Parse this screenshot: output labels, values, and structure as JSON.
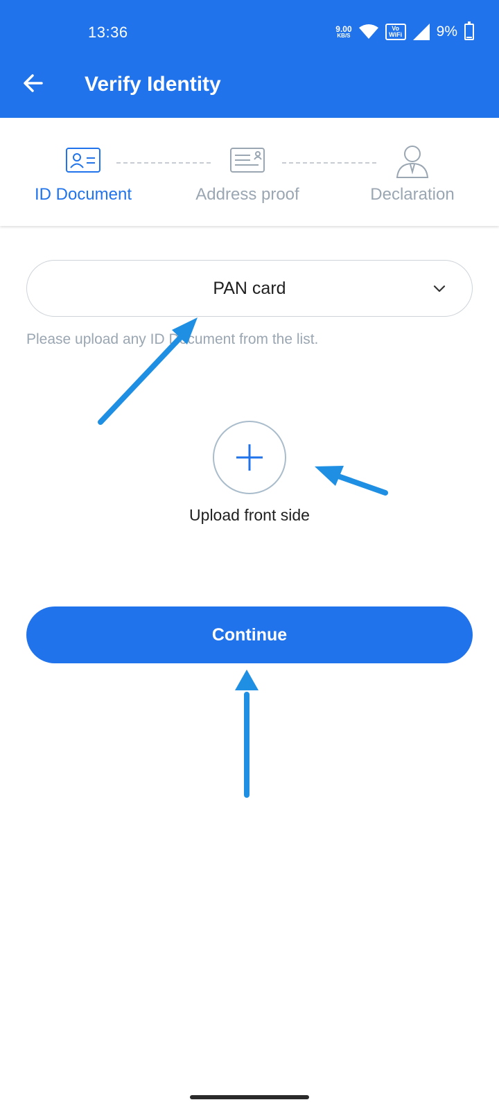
{
  "status_bar": {
    "time": "13:36",
    "net_speed_value": "9.00",
    "net_speed_unit": "KB/S",
    "vowifi_top": "Vo",
    "vowifi_bottom": "WiFi",
    "battery": "9%"
  },
  "header": {
    "title": "Verify Identity",
    "back_icon": "arrow-left-icon"
  },
  "stepper": {
    "steps": [
      {
        "label": "ID Document",
        "icon": "id-card-icon",
        "active": true
      },
      {
        "label": "Address proof",
        "icon": "address-card-icon",
        "active": false
      },
      {
        "label": "Declaration",
        "icon": "person-icon",
        "active": false
      }
    ]
  },
  "form": {
    "document_select_value": "PAN card",
    "helper_text": "Please upload any ID Document from the list.",
    "upload_label": "Upload front side",
    "continue_label": "Continue"
  },
  "colors": {
    "primary": "#2073ea",
    "muted": "#9aa6b2",
    "annotation_arrow": "#1e8fe3"
  }
}
